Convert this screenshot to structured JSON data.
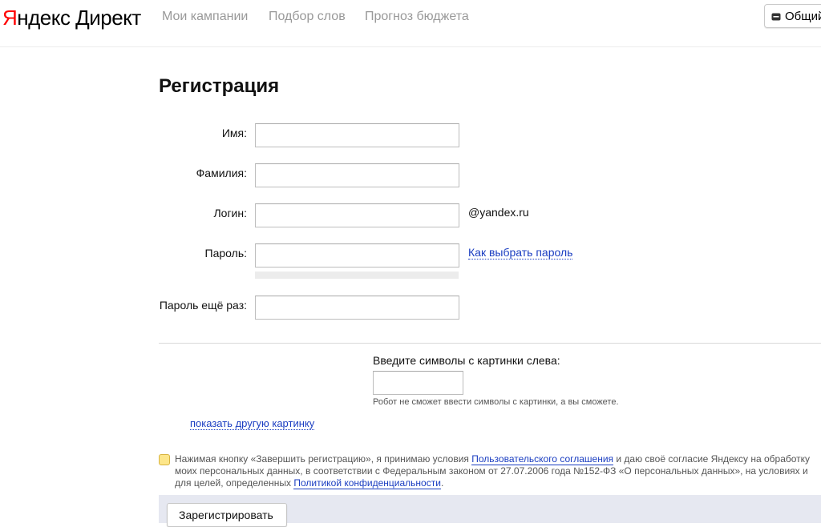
{
  "header": {
    "logo_yandex_first": "Я",
    "logo_yandex_rest": "ндекс",
    "logo_direct": "Директ",
    "nav": [
      "Мои кампании",
      "Подбор слов",
      "Прогноз бюджета"
    ],
    "general_button": "Общий"
  },
  "form": {
    "title": "Регистрация",
    "fields": {
      "first_name": {
        "label": "Имя:",
        "value": ""
      },
      "last_name": {
        "label": "Фамилия:",
        "value": ""
      },
      "login": {
        "label": "Логин:",
        "value": "",
        "suffix": "@yandex.ru"
      },
      "password": {
        "label": "Пароль:",
        "value": "",
        "help_link": "Как выбрать пароль"
      },
      "password_repeat": {
        "label": "Пароль ещё раз:",
        "value": ""
      }
    }
  },
  "captcha": {
    "title": "Введите символы с картинки слева:",
    "value": "",
    "hint": "Робот не сможет ввести символы с картинки, а вы сможете.",
    "other_picture_link": "показать другую картинку"
  },
  "agreement": {
    "checked": false,
    "text_1": "Нажимая кнопку «Завершить регистрацию», я принимаю условия ",
    "link_1": "Пользовательского соглашения",
    "text_2": " и даю своё согласие Яндексу на обработку моих персональных данных, в соответствии с Федеральным законом от 27.07.2006 года №152-ФЗ «О персональных данных», на условиях и для целей, определенных ",
    "link_2": "Политикой конфиденциальности",
    "text_3": "."
  },
  "submit_button": "Зарегистрировать",
  "colors": {
    "logo_red": "#ff0000",
    "link_blue": "#1a3dc1",
    "checkbox_yellow": "#fde68a",
    "footer_band": "#e6e8f1"
  }
}
